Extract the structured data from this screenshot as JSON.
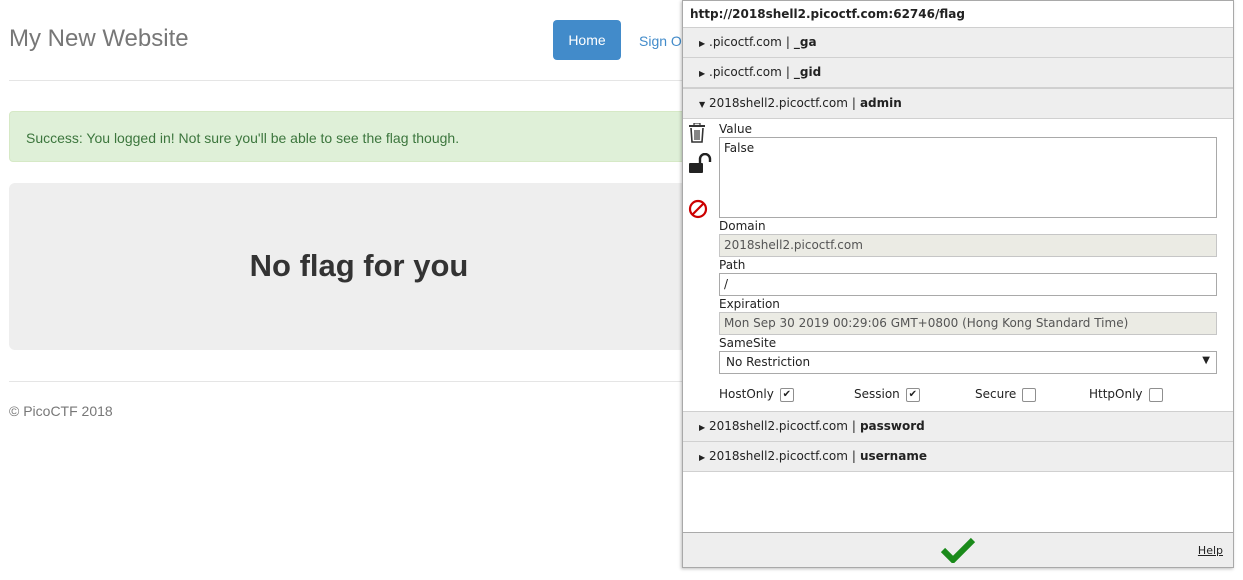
{
  "site": {
    "title": "My New Website",
    "nav_home": "Home",
    "nav_signout": "Sign Out",
    "alert_message": "Success: You logged in! Not sure you'll be able to see the flag though.",
    "jumbotron_heading": "No flag for you",
    "footer": "© PicoCTF 2018"
  },
  "cookie_panel": {
    "url": "http://2018shell2.picoctf.com:62746/flag",
    "separator": "|",
    "cookies_before": [
      {
        "domain": ".picoctf.com",
        "name": "_ga"
      },
      {
        "domain": ".picoctf.com",
        "name": "_gid"
      }
    ],
    "expanded": {
      "domain": "2018shell2.picoctf.com",
      "name": "admin",
      "value_label": "Value",
      "value": "False",
      "domain_label": "Domain",
      "domain_value": "2018shell2.picoctf.com",
      "path_label": "Path",
      "path_value": "/",
      "expiration_label": "Expiration",
      "expiration_value": "Mon Sep 30 2019 00:29:06 GMT+0800 (Hong Kong Standard Time)",
      "samesite_label": "SameSite",
      "samesite_value": "No Restriction",
      "hostonly_label": "HostOnly",
      "session_label": "Session",
      "secure_label": "Secure",
      "httponly_label": "HttpOnly",
      "hostonly_checked": true,
      "session_checked": true,
      "secure_checked": false,
      "httponly_checked": false
    },
    "cookies_after": [
      {
        "domain": "2018shell2.picoctf.com",
        "name": "password"
      },
      {
        "domain": "2018shell2.picoctf.com",
        "name": "username"
      }
    ],
    "help_label": "Help"
  },
  "colors": {
    "primary": "#428bca",
    "success_bg": "#dff0d8",
    "success_text": "#3c763d",
    "save_check": "#1a8a1a",
    "block_red": "#cc0000"
  },
  "icons": [
    "trash-icon",
    "unlock-icon",
    "block-icon",
    "save-check-icon",
    "expand-triangle-icon",
    "collapse-triangle-icon"
  ]
}
